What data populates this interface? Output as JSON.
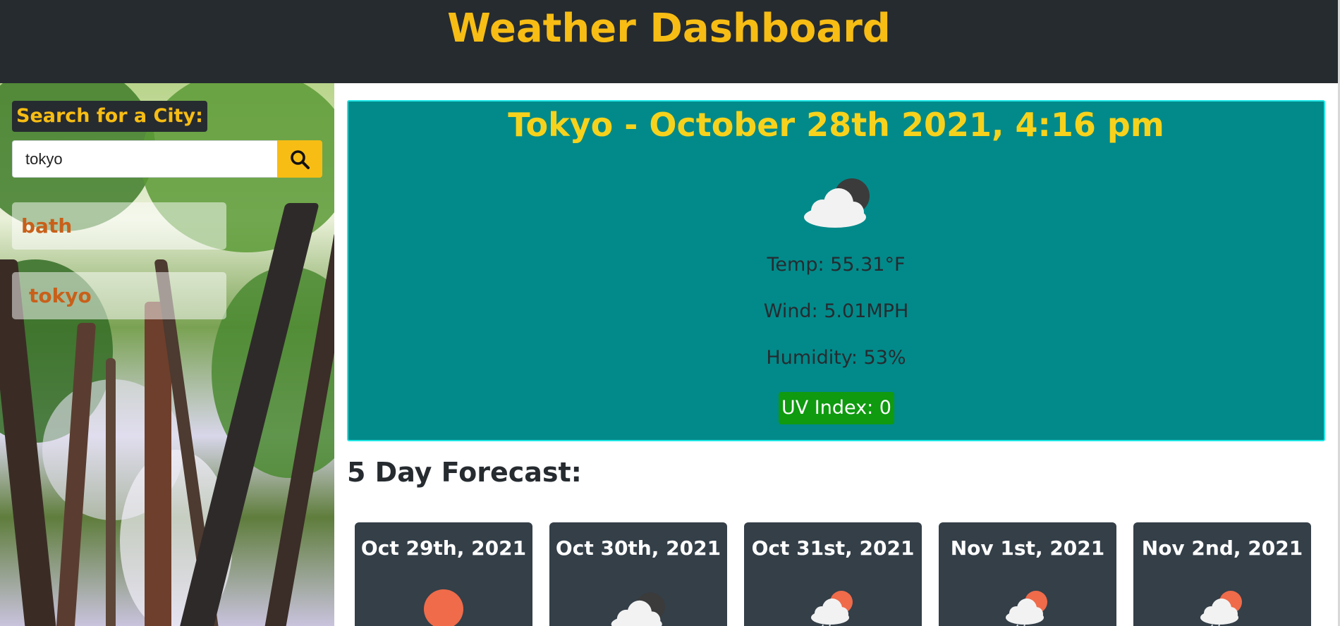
{
  "header": {
    "title": "Weather Dashboard"
  },
  "sidebar": {
    "search_label": "Search for a City:",
    "search_value": "tokyo",
    "search_icon": "search-icon",
    "history": [
      {
        "label": "bath"
      },
      {
        "label": "tokyo"
      }
    ]
  },
  "current": {
    "title": "Tokyo - October 28th 2021, 4:16 pm",
    "icon": "cloud-night-icon",
    "temp": "Temp: 55.31°F",
    "wind": "Wind: 5.01MPH",
    "humidity": "Humidity: 53%",
    "uv": "UV Index: 0",
    "uv_color": "#0f9a10",
    "card_color": "#028a8a",
    "title_color": "#f7d21c"
  },
  "forecast": {
    "heading": "5 Day Forecast:",
    "days": [
      {
        "date": "Oct 29th, 2021",
        "icon": "sun-icon"
      },
      {
        "date": "Oct 30th, 2021",
        "icon": "cloud-night-icon"
      },
      {
        "date": "Oct 31st, 2021",
        "icon": "cloud-sun-icon"
      },
      {
        "date": "Nov 1st, 2021",
        "icon": "cloud-sun-icon"
      },
      {
        "date": "Nov 2nd, 2021",
        "icon": "cloud-sun-icon"
      }
    ]
  },
  "colors": {
    "accent": "#f7bd14",
    "header_bg": "#262b30",
    "forecast_card_bg": "#343f48"
  }
}
